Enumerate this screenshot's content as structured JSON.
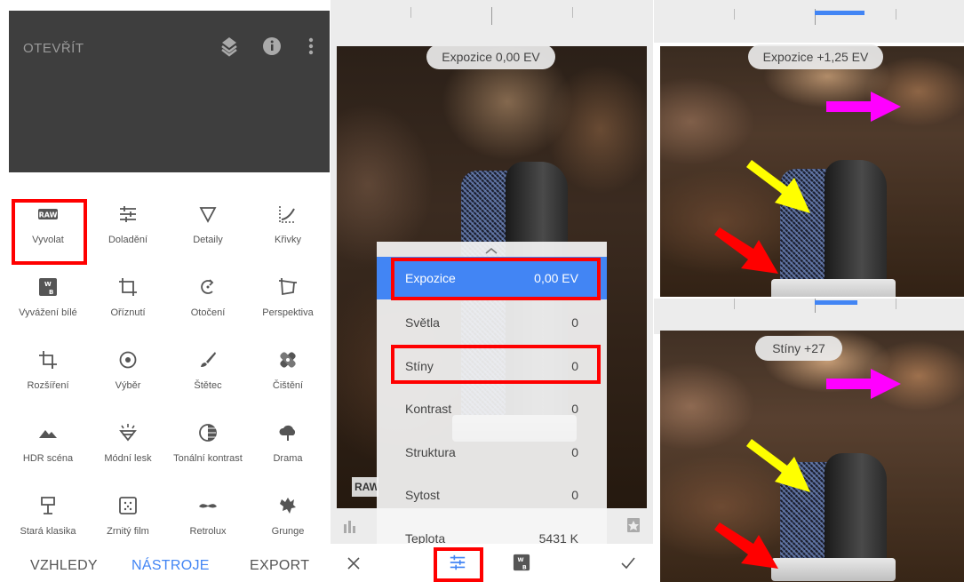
{
  "panel1": {
    "header_title": "OTEVŘÍT",
    "header_icons": [
      "layers-icon",
      "info-icon",
      "more-vert-icon"
    ],
    "tools": [
      {
        "label": "Vyvolat",
        "icon": "raw-icon"
      },
      {
        "label": "Doladění",
        "icon": "tune-icon"
      },
      {
        "label": "Detaily",
        "icon": "triangle-down-icon"
      },
      {
        "label": "Křivky",
        "icon": "curves-icon"
      },
      {
        "label": "Vyvážení bílé",
        "icon": "white-balance-icon"
      },
      {
        "label": "Oříznutí",
        "icon": "crop-icon"
      },
      {
        "label": "Otočení",
        "icon": "rotate-icon"
      },
      {
        "label": "Perspektiva",
        "icon": "perspective-icon"
      },
      {
        "label": "Rozšíření",
        "icon": "expand-icon"
      },
      {
        "label": "Výběr",
        "icon": "selective-icon"
      },
      {
        "label": "Štětec",
        "icon": "brush-icon"
      },
      {
        "label": "Čištění",
        "icon": "healing-icon"
      },
      {
        "label": "HDR scéna",
        "icon": "mountain-icon"
      },
      {
        "label": "Módní lesk",
        "icon": "glamour-icon"
      },
      {
        "label": "Tonální kontrast",
        "icon": "tonal-contrast-icon"
      },
      {
        "label": "Drama",
        "icon": "cloud-icon"
      },
      {
        "label": "Stará klasika",
        "icon": "lamp-icon"
      },
      {
        "label": "Zrnitý film",
        "icon": "grain-icon"
      },
      {
        "label": "Retrolux",
        "icon": "mustache-icon"
      },
      {
        "label": "Grunge",
        "icon": "grunge-icon"
      }
    ],
    "bottom_nav": {
      "looks": "VZHLEDY",
      "tools": "NÁSTROJE",
      "export": "EXPORT"
    }
  },
  "panel2": {
    "exposure_pill": "Expozice 0,00 EV",
    "raw_badge": "RAW",
    "menu": [
      {
        "key": "Expozice",
        "value": "0,00 EV"
      },
      {
        "key": "Světla",
        "value": "0"
      },
      {
        "key": "Stíny",
        "value": "0"
      },
      {
        "key": "Kontrast",
        "value": "0"
      },
      {
        "key": "Struktura",
        "value": "0"
      },
      {
        "key": "Sytost",
        "value": "0"
      },
      {
        "key": "Teplota",
        "value": "5431 K"
      }
    ],
    "bottom_icons": [
      "close-icon",
      "tune-icon",
      "white-balance-icon",
      "check-icon"
    ]
  },
  "panel3": {
    "top_pill": "Expozice +1,25 EV",
    "bottom_pill": "Stíny +27"
  },
  "colors": {
    "accent_blue": "#4285f4",
    "highlight_red": "#ff0000",
    "arrow_magenta": "#ff00ff",
    "arrow_yellow": "#ffff00",
    "arrow_red": "#ff0000"
  }
}
